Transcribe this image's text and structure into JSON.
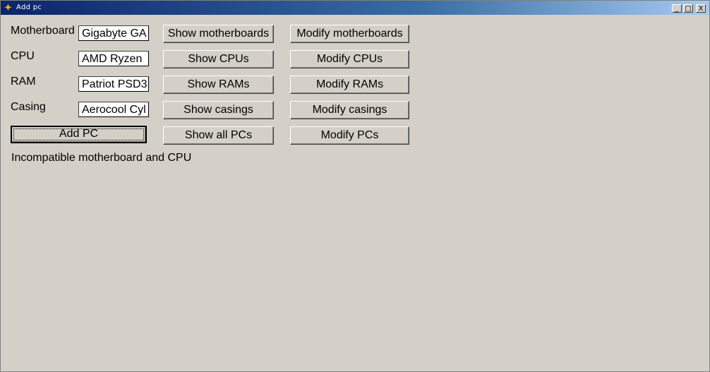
{
  "window": {
    "title": "Add pc",
    "controls": {
      "minimize": "_",
      "maximize": "□",
      "close": "X"
    }
  },
  "form": {
    "motherboard": {
      "label": "Motherboard",
      "value": "Gigabyte GA"
    },
    "cpu": {
      "label": "CPU",
      "value": "AMD Ryzen"
    },
    "ram": {
      "label": "RAM",
      "value": "Patriot PSD3"
    },
    "casing": {
      "label": "Casing",
      "value": "Aerocool Cyl"
    },
    "add_button": "Add PC"
  },
  "show_buttons": {
    "motherboards": "Show motherboards",
    "cpus": "Show CPUs",
    "rams": "Show RAMs",
    "casings": "Show casings",
    "all_pcs": "Show all PCs"
  },
  "modify_buttons": {
    "motherboards": "Modify motherboards",
    "cpus": "Modify CPUs",
    "rams": "Modify RAMs",
    "casings": "Modify casings",
    "pcs": "Modify PCs"
  },
  "status": {
    "message": "Incompatible motherboard and CPU"
  },
  "colors": {
    "window_bg": "#d4d0c8",
    "titlebar_start": "#0a246a",
    "titlebar_end": "#a6caf0"
  }
}
